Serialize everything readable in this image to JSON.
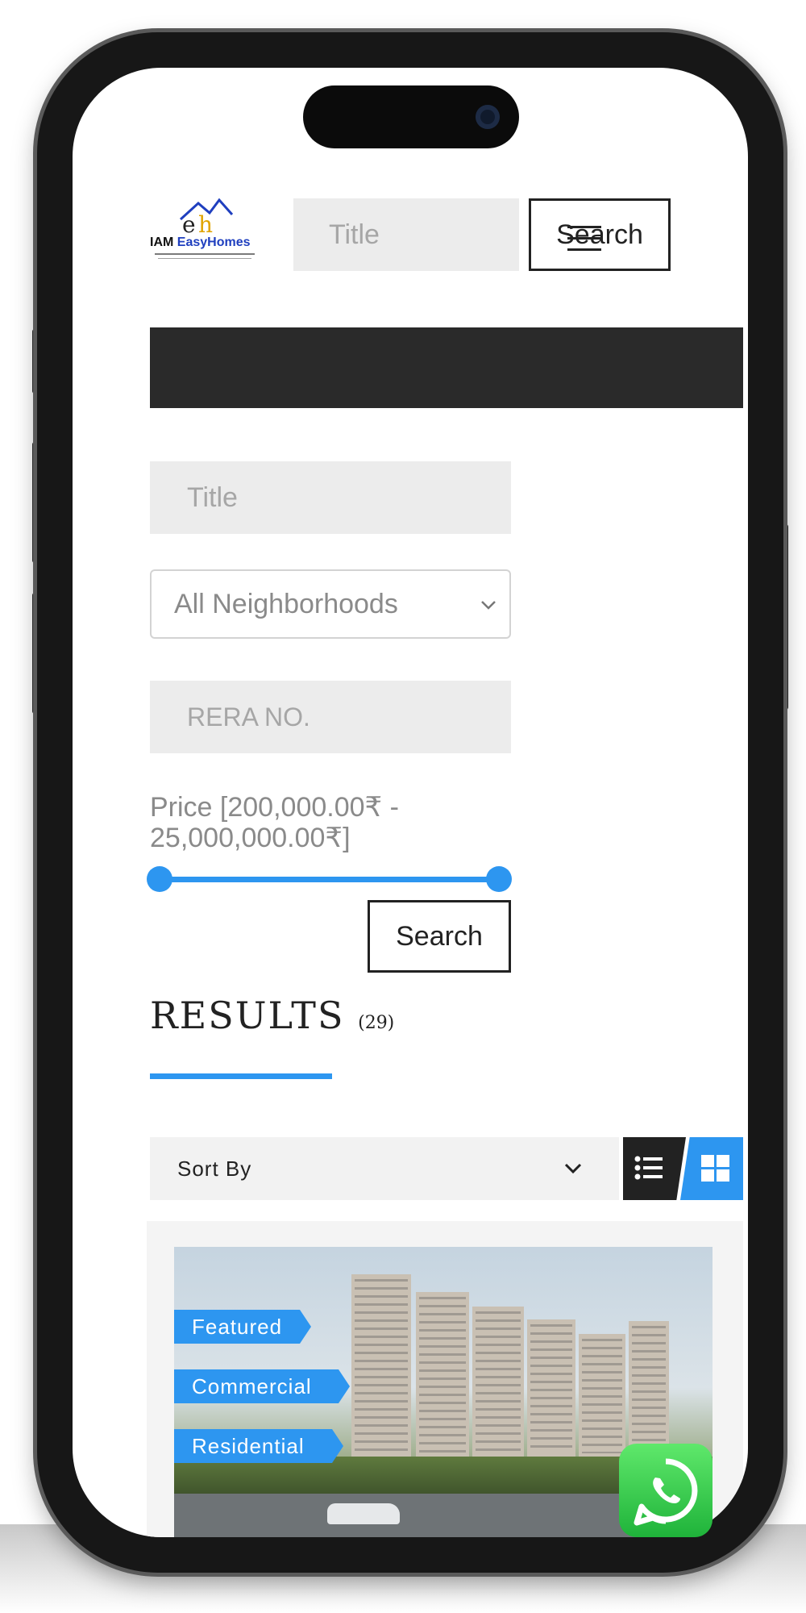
{
  "header": {
    "logo": {
      "brand_left": "IAM",
      "brand_right": "EasyHomes"
    },
    "search_input_placeholder": "Title",
    "search_button_label": "Search"
  },
  "filters": {
    "title_placeholder": "Title",
    "neighborhood_selected": "All Neighborhoods",
    "rera_placeholder": "RERA NO.",
    "price_label": "Price [200,000.00₹ - 25,000,000.00₹]",
    "price_range": {
      "min": 200000,
      "max": 25000000,
      "selected_min": 200000,
      "selected_max": 25000000
    },
    "search_button_label": "Search"
  },
  "results": {
    "title": "RESULTS",
    "count_text": "(29)",
    "sort_label": "Sort By",
    "view_mode": "grid"
  },
  "listing": {
    "tags": [
      "Featured",
      "Commercial",
      "Residential"
    ]
  },
  "colors": {
    "accent": "#2d96f0",
    "dark": "#222222",
    "whatsapp": "#25d366"
  }
}
